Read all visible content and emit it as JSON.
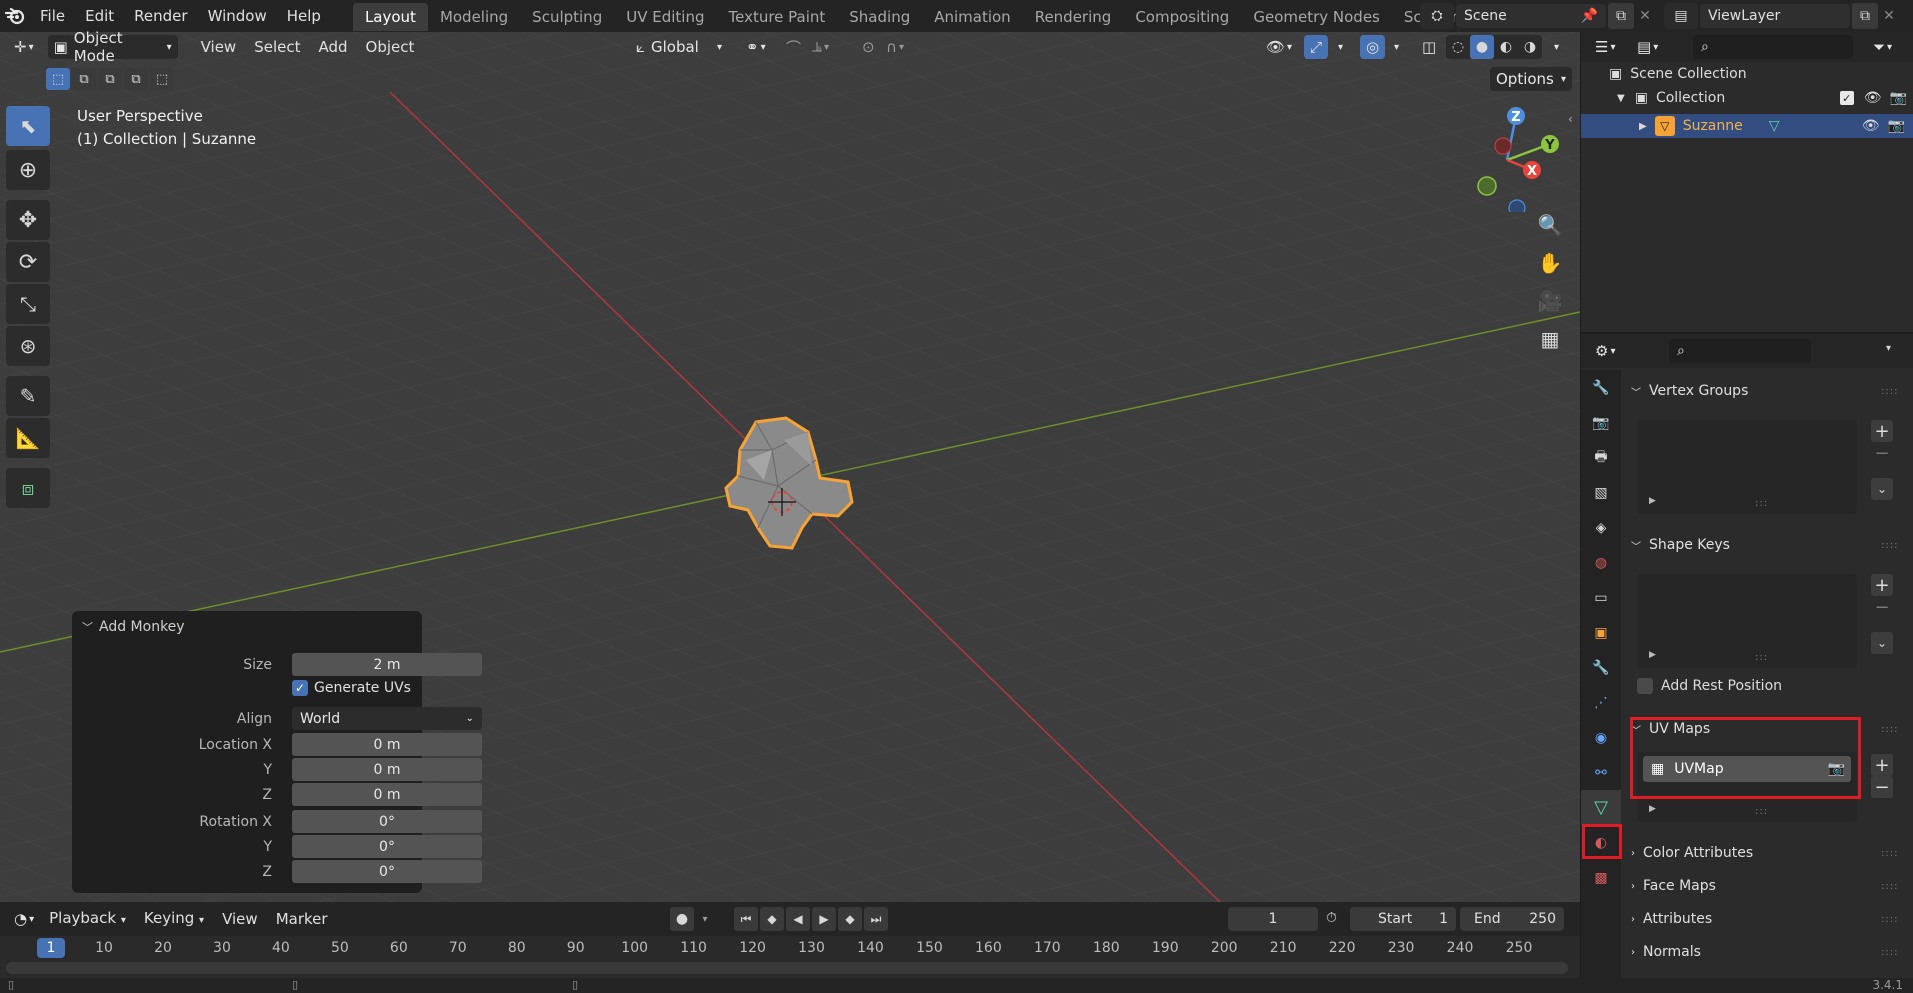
{
  "top_menu": [
    "File",
    "Edit",
    "Render",
    "Window",
    "Help"
  ],
  "workspaces": [
    "Layout",
    "Modeling",
    "Sculpting",
    "UV Editing",
    "Texture Paint",
    "Shading",
    "Animation",
    "Rendering",
    "Compositing",
    "Geometry Nodes",
    "Scripting"
  ],
  "add_workspace": "+",
  "scene_name": "Scene",
  "view_layer_name": "ViewLayer",
  "viewport_header": {
    "mode": "Object Mode",
    "menus": [
      "View",
      "Select",
      "Add",
      "Object"
    ],
    "transform_orientation": "Global",
    "options_label": "Options"
  },
  "viewport_overlay": {
    "perspective": "User Perspective",
    "collection_info": "(1) Collection | Suzanne"
  },
  "gizmo_axes": {
    "x": "X",
    "y": "Y",
    "z": "Z"
  },
  "redo_panel": {
    "title": "Add Monkey",
    "size_label": "Size",
    "size_value": "2 m",
    "generate_uvs_label": "Generate UVs",
    "align_label": "Align",
    "align_value": "World",
    "location_label": "Location X",
    "loc_x": "0 m",
    "y_label": "Y",
    "loc_y": "0 m",
    "z_label": "Z",
    "loc_z": "0 m",
    "rotation_label": "Rotation X",
    "rot_x": "0°",
    "rot_y": "0°",
    "rot_z": "0°"
  },
  "timeline": {
    "menus": [
      "Playback",
      "Keying",
      "View",
      "Marker"
    ],
    "current_frame": "1",
    "start_label": "Start",
    "start_value": "1",
    "end_label": "End",
    "end_value": "250",
    "ruler_ticks": [
      "1",
      "10",
      "20",
      "30",
      "40",
      "50",
      "60",
      "70",
      "80",
      "90",
      "100",
      "110",
      "120",
      "130",
      "140",
      "150",
      "160",
      "170",
      "180",
      "190",
      "200",
      "210",
      "220",
      "230",
      "240",
      "250"
    ]
  },
  "outliner": {
    "scene_collection": "Scene Collection",
    "collection": "Collection",
    "object": "Suzanne"
  },
  "properties": {
    "vertex_groups": "Vertex Groups",
    "shape_keys": "Shape Keys",
    "add_rest_position": "Add Rest Position",
    "uv_maps": "UV Maps",
    "uv_map_item": "UVMap",
    "color_attributes": "Color Attributes",
    "face_maps": "Face Maps",
    "attributes": "Attributes",
    "normals": "Normals"
  },
  "version": "3.4.1",
  "colors": {
    "accent": "#4772b3",
    "selection_outline": "#f5a337",
    "x_axis": "#e8443a",
    "y_axis": "#8cc63f",
    "z_axis": "#4e8ede",
    "highlight_box": "#e01b24"
  }
}
